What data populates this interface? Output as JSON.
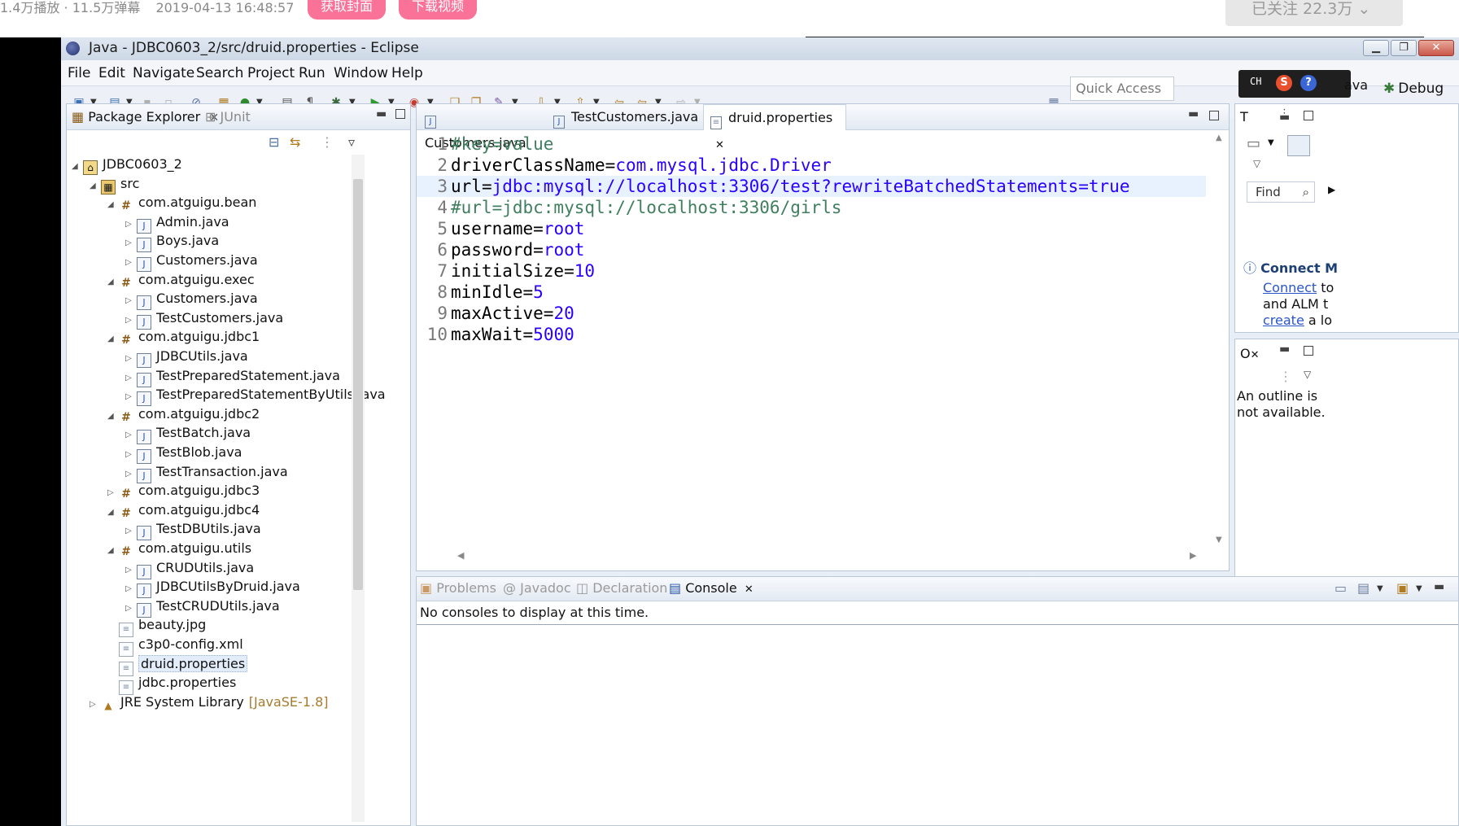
{
  "video": {
    "stats": [
      "1.4万播放 · 11.5万弹幕",
      "2019-04-13 16:48:57"
    ],
    "cover_button": "获取封面",
    "download_button": "下载视频",
    "follow_button": "已关注 22.3万 ⌄"
  },
  "window": {
    "title": "Java - JDBC0603_2/src/druid.properties - Eclipse"
  },
  "menu": [
    "File",
    "Edit",
    "Navigate",
    "Search",
    "Project",
    "Run",
    "Window",
    "Help"
  ],
  "toolbar": {
    "quick_access": "Quick Access",
    "ime_label": "CH",
    "ime_s": "S",
    "ime_help": "?",
    "perspective_java": "ava",
    "perspective_debug": "Debug"
  },
  "package_explorer": {
    "tab": "Package Explorer",
    "junit_tab": "JUnit",
    "tree": [
      {
        "label": "JDBC0603_2",
        "kind": "project",
        "depth": 0,
        "expanded": true
      },
      {
        "label": "src",
        "kind": "src",
        "depth": 1,
        "expanded": true
      },
      {
        "label": "com.atguigu.bean",
        "kind": "pkg",
        "depth": 2,
        "expanded": true
      },
      {
        "label": "Admin.java",
        "kind": "java",
        "depth": 3
      },
      {
        "label": "Boys.java",
        "kind": "java",
        "depth": 3
      },
      {
        "label": "Customers.java",
        "kind": "java",
        "depth": 3
      },
      {
        "label": "com.atguigu.exec",
        "kind": "pkg",
        "depth": 2,
        "expanded": true
      },
      {
        "label": "Customers.java",
        "kind": "java",
        "depth": 3
      },
      {
        "label": "TestCustomers.java",
        "kind": "java",
        "depth": 3
      },
      {
        "label": "com.atguigu.jdbc1",
        "kind": "pkg",
        "depth": 2,
        "expanded": true
      },
      {
        "label": "JDBCUtils.java",
        "kind": "java",
        "depth": 3
      },
      {
        "label": "TestPreparedStatement.java",
        "kind": "java",
        "depth": 3
      },
      {
        "label": "TestPreparedStatementByUtils.java",
        "kind": "java",
        "depth": 3
      },
      {
        "label": "com.atguigu.jdbc2",
        "kind": "pkg",
        "depth": 2,
        "expanded": true
      },
      {
        "label": "TestBatch.java",
        "kind": "java",
        "depth": 3
      },
      {
        "label": "TestBlob.java",
        "kind": "java",
        "depth": 3
      },
      {
        "label": "TestTransaction.java",
        "kind": "java",
        "depth": 3
      },
      {
        "label": "com.atguigu.jdbc3",
        "kind": "pkg",
        "depth": 2,
        "expanded": false
      },
      {
        "label": "com.atguigu.jdbc4",
        "kind": "pkg",
        "depth": 2,
        "expanded": true
      },
      {
        "label": "TestDBUtils.java",
        "kind": "java",
        "depth": 3
      },
      {
        "label": "com.atguigu.utils",
        "kind": "pkg",
        "depth": 2,
        "expanded": true
      },
      {
        "label": "CRUDUtils.java",
        "kind": "java",
        "depth": 3
      },
      {
        "label": "JDBCUtilsByDruid.java",
        "kind": "java",
        "depth": 3
      },
      {
        "label": "TestCRUDUtils.java",
        "kind": "java",
        "depth": 3
      },
      {
        "label": "beauty.jpg",
        "kind": "file",
        "depth": 2
      },
      {
        "label": "c3p0-config.xml",
        "kind": "file",
        "depth": 2
      },
      {
        "label": "druid.properties",
        "kind": "file",
        "depth": 2,
        "selected": true
      },
      {
        "label": "jdbc.properties",
        "kind": "file",
        "depth": 2
      },
      {
        "label": "JRE System Library",
        "kind": "lib",
        "depth": 1,
        "expanded": false,
        "suffix": "[JavaSE-1.8]"
      }
    ]
  },
  "editor": {
    "tabs": [
      {
        "label": "Customers.java",
        "active": false
      },
      {
        "label": "TestCustomers.java",
        "active": false
      },
      {
        "label": "druid.properties",
        "active": true
      }
    ],
    "lines": [
      {
        "n": "1",
        "kind": "comment",
        "text": "#key=value"
      },
      {
        "n": "2",
        "kind": "prop",
        "key": "driverClassName",
        "value": "com.mysql.jdbc.Driver"
      },
      {
        "n": "3",
        "kind": "prop",
        "key": "url",
        "value": "jdbc:mysql://localhost:3306/test?rewriteBatchedStatements=true",
        "current": true
      },
      {
        "n": "4",
        "kind": "comment",
        "text": "#url=jdbc:mysql://localhost:3306/girls"
      },
      {
        "n": "5",
        "kind": "prop",
        "key": "username",
        "value": "root"
      },
      {
        "n": "6",
        "kind": "prop",
        "key": "password",
        "value": "root"
      },
      {
        "n": "7",
        "kind": "prop",
        "key": "initialSize",
        "value": "10"
      },
      {
        "n": "8",
        "kind": "prop",
        "key": "minIdle",
        "value": "5"
      },
      {
        "n": "9",
        "kind": "prop",
        "key": "maxActive",
        "value": "20"
      },
      {
        "n": "10",
        "kind": "prop",
        "key": "maxWait",
        "value": "5000"
      }
    ]
  },
  "task_panel": {
    "title_letter": "T",
    "find_label": "Find",
    "connect_title": "Connect M",
    "connect_link": "Connect",
    "connect_to": "to",
    "connect_and": "and ALM t",
    "create_link": "create",
    "create_rest": "a lo"
  },
  "outline": {
    "tab": "O",
    "message_line1": "An outline is",
    "message_line2": "not available."
  },
  "console": {
    "tabs": [
      "Problems",
      "Javadoc",
      "Declaration",
      "Console"
    ],
    "message": "No consoles to display at this time."
  },
  "colors": {
    "keyword_value": "#2a00ff",
    "comment": "#3f7f5f",
    "current_line": "#e8f2fe",
    "brand_pink": "#fb7299"
  }
}
